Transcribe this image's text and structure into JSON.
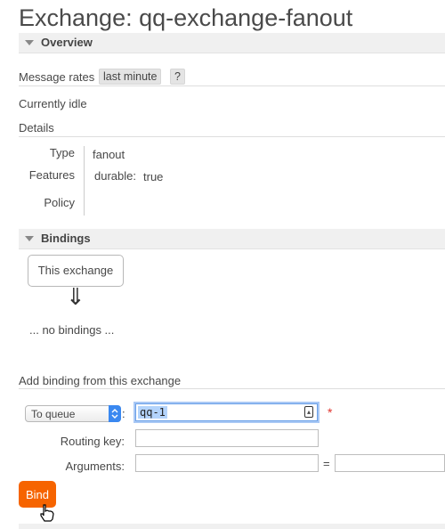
{
  "page": {
    "title": "Exchange: qq-exchange-fanout"
  },
  "overview": {
    "header": "Overview",
    "message_rates_label": "Message rates",
    "rate_period": "last minute",
    "help": "?",
    "status": "Currently idle",
    "details_label": "Details",
    "details": {
      "type_label": "Type",
      "type_value": "fanout",
      "features_label": "Features",
      "durable_label": "durable:",
      "durable_value": "true",
      "policy_label": "Policy",
      "policy_value": ""
    }
  },
  "bindings": {
    "header": "Bindings",
    "source_box": "This exchange",
    "arrow": "⇓",
    "empty_text": "... no bindings ..."
  },
  "add_binding": {
    "title": "Add binding from this exchange",
    "destination_type": "To queue",
    "colon": ":",
    "destination_value": "qq-1",
    "required_marker": "*",
    "routing_key_label": "Routing key:",
    "routing_key_value": "",
    "arguments_label": "Arguments:",
    "argument_key_value": "",
    "equals": "=",
    "argument_value": "",
    "bind_button": "Bind"
  },
  "icons": [
    "triangle-down-icon",
    "updown-arrows-icon",
    "keychain-icon",
    "hand-cursor-icon"
  ]
}
